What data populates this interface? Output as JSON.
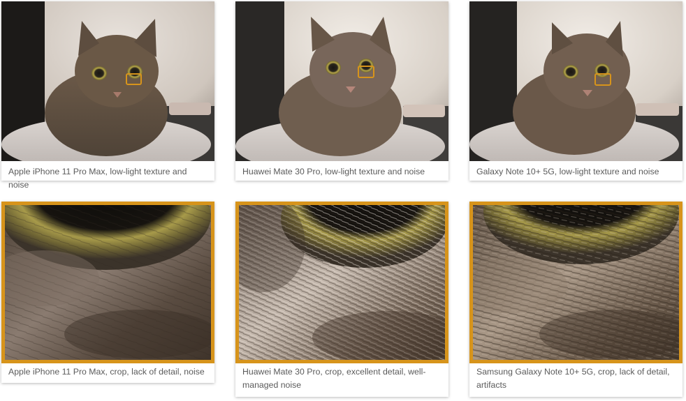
{
  "colors": {
    "crop_border": "#d7941b",
    "caption_text": "#5a5a5a",
    "card_background": "#ffffff"
  },
  "gallery": {
    "rows": [
      {
        "items": [
          {
            "caption": "Apple iPhone 11 Pro Max, low-light texture and noise",
            "image": "cat-photo-iphone"
          },
          {
            "caption": "Huawei Mate 30 Pro, low-light texture and noise",
            "image": "cat-photo-huawei"
          },
          {
            "caption": "Galaxy Note 10+ 5G, low-light texture and noise",
            "image": "cat-photo-galaxy"
          }
        ]
      },
      {
        "items": [
          {
            "caption": "Apple iPhone 11 Pro Max, crop, lack of detail, noise",
            "image": "eye-crop-iphone"
          },
          {
            "caption": "Huawei Mate 30 Pro, crop, excellent detail, well-managed noise",
            "image": "eye-crop-huawei"
          },
          {
            "caption": "Samsung Galaxy Note 10+ 5G, crop, lack of detail, artifacts",
            "image": "eye-crop-galaxy"
          }
        ]
      }
    ]
  }
}
